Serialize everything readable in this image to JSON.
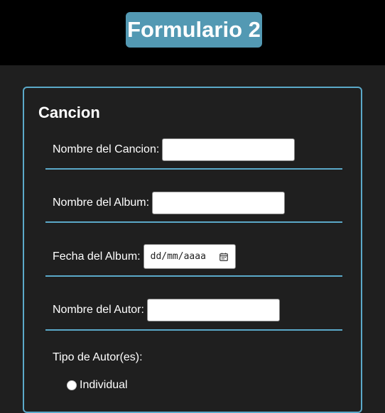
{
  "header": {
    "title": "Formulario 2",
    "accent_color": "#5399b3"
  },
  "form": {
    "section_title": "Cancion",
    "fields": {
      "song_name": {
        "label": "Nombre del Cancion:",
        "value": ""
      },
      "album_name": {
        "label": "Nombre del Album:",
        "value": ""
      },
      "album_date": {
        "label": "Fecha del Album:",
        "placeholder": "dd/mm/aaaa",
        "icon": "calendar-icon"
      },
      "author_name": {
        "label": "Nombre del Autor:",
        "value": ""
      }
    },
    "author_type": {
      "label": "Tipo de Autor(es):",
      "options": [
        "Individual"
      ]
    },
    "divider_color": "#5ba9c9"
  }
}
